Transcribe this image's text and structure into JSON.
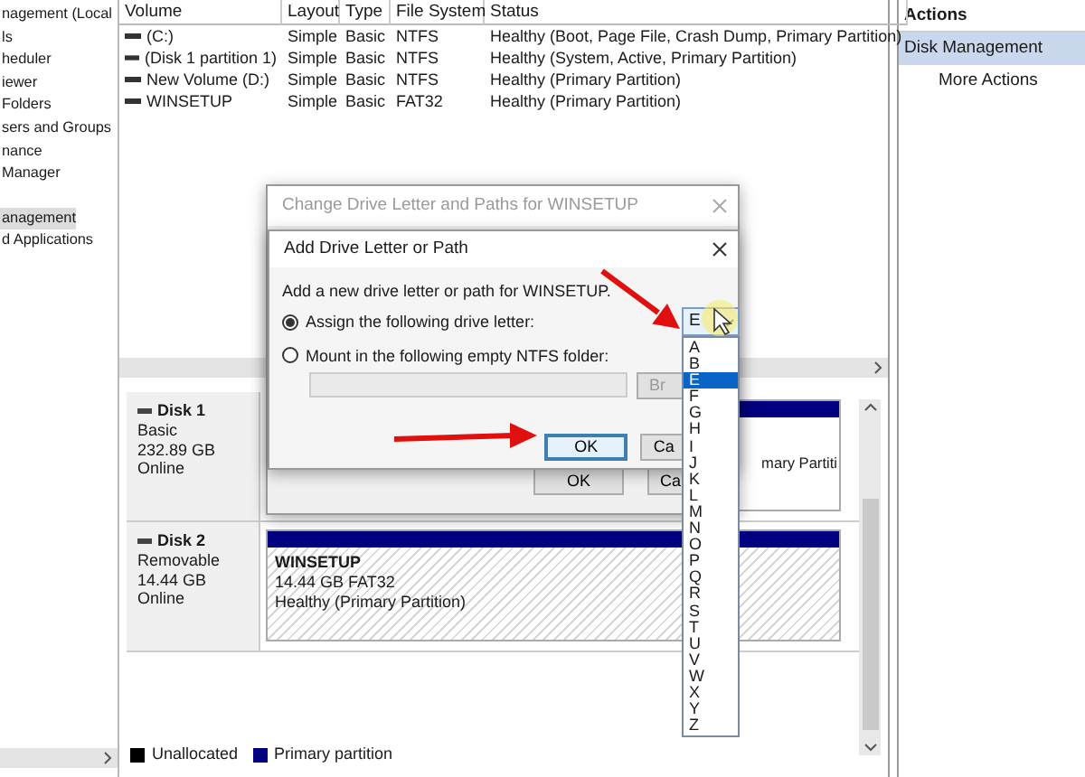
{
  "sidebar": {
    "sections": [
      {
        "items": [
          {
            "label": "nagement (Local",
            "selected": false
          },
          {
            "label": "ls",
            "selected": false
          },
          {
            "label": "heduler",
            "selected": false
          },
          {
            "label": "iewer",
            "selected": false
          },
          {
            "label": "Folders",
            "selected": false
          },
          {
            "label": "sers and Groups",
            "selected": false
          },
          {
            "label": "nance",
            "selected": false
          },
          {
            "label": "Manager",
            "selected": false
          }
        ]
      },
      {
        "items": [
          {
            "label": "anagement",
            "selected": true
          },
          {
            "label": "d Applications",
            "selected": false
          }
        ]
      }
    ]
  },
  "volume_table": {
    "columns": [
      "Volume",
      "Layout",
      "Type",
      "File System",
      "Status"
    ],
    "rows": [
      {
        "cells": [
          "(C:)",
          "Simple",
          "Basic",
          "NTFS",
          "Healthy (Boot, Page File, Crash Dump, Primary Partition)"
        ]
      },
      {
        "cells": [
          "(Disk 1 partition 1)",
          "Simple",
          "Basic",
          "NTFS",
          "Healthy (System, Active, Primary Partition)"
        ]
      },
      {
        "cells": [
          "New Volume (D:)",
          "Simple",
          "Basic",
          "NTFS",
          "Healthy (Primary Partition)"
        ]
      },
      {
        "cells": [
          "WINSETUP",
          "Simple",
          "Basic",
          "FAT32",
          "Healthy (Primary Partition)"
        ]
      }
    ]
  },
  "disks": [
    {
      "name": "Disk 1",
      "type": "Basic",
      "size": "232.89 GB",
      "state": "Online",
      "partitions": [
        {
          "lines": [
            "mary Partiti"
          ],
          "selected": false
        }
      ]
    },
    {
      "name": "Disk 2",
      "type": "Removable",
      "size": "14.44 GB",
      "state": "Online",
      "partitions": [
        {
          "lines": [
            "WINSETUP",
            "14.44 GB FAT32",
            "Healthy (Primary Partition)"
          ],
          "selected": true
        }
      ]
    }
  ],
  "legend": [
    {
      "label": "Unallocated",
      "color": "#000000"
    },
    {
      "label": "Primary partition",
      "color": "#000080"
    }
  ],
  "actions": {
    "title": "Actions",
    "items": [
      {
        "label": "Disk Management",
        "selected": true
      },
      {
        "label": "More Actions",
        "selected": false
      }
    ]
  },
  "change_dialog": {
    "title": "Change Drive Letter and Paths for WINSETUP",
    "buttons": [
      {
        "label": "OK",
        "focused": false
      },
      {
        "label": "Ca",
        "focused": false
      }
    ]
  },
  "add_dialog": {
    "title": "Add Drive Letter or Path",
    "prompt": "Add a new drive letter or path for WINSETUP.",
    "options": [
      {
        "label": "Assign the following drive letter:",
        "selected": true
      },
      {
        "label": "Mount in the following empty NTFS folder:",
        "selected": false
      }
    ],
    "folder_field": {
      "disabled": true
    },
    "browse_button": "Br",
    "buttons": [
      {
        "label": "OK",
        "focused": true
      },
      {
        "label": "Ca",
        "focused": false
      }
    ]
  },
  "drive_letter_dropdown": {
    "value": "E",
    "options": [
      {
        "label": "A",
        "selected": false
      },
      {
        "label": "B",
        "selected": false
      },
      {
        "label": "E",
        "selected": true
      },
      {
        "label": "F",
        "selected": false
      },
      {
        "label": "G",
        "selected": false
      },
      {
        "label": "H",
        "selected": false
      },
      {
        "label": "I",
        "selected": false
      },
      {
        "label": "J",
        "selected": false
      },
      {
        "label": "K",
        "selected": false
      },
      {
        "label": "L",
        "selected": false
      },
      {
        "label": "M",
        "selected": false
      },
      {
        "label": "N",
        "selected": false
      },
      {
        "label": "O",
        "selected": false
      },
      {
        "label": "P",
        "selected": false
      },
      {
        "label": "Q",
        "selected": false
      },
      {
        "label": "R",
        "selected": false
      },
      {
        "label": "S",
        "selected": false
      },
      {
        "label": "T",
        "selected": false
      },
      {
        "label": "U",
        "selected": false
      },
      {
        "label": "V",
        "selected": false
      },
      {
        "label": "W",
        "selected": false
      },
      {
        "label": "X",
        "selected": false
      },
      {
        "label": "Y",
        "selected": false
      },
      {
        "label": "Z",
        "selected": false
      }
    ]
  }
}
